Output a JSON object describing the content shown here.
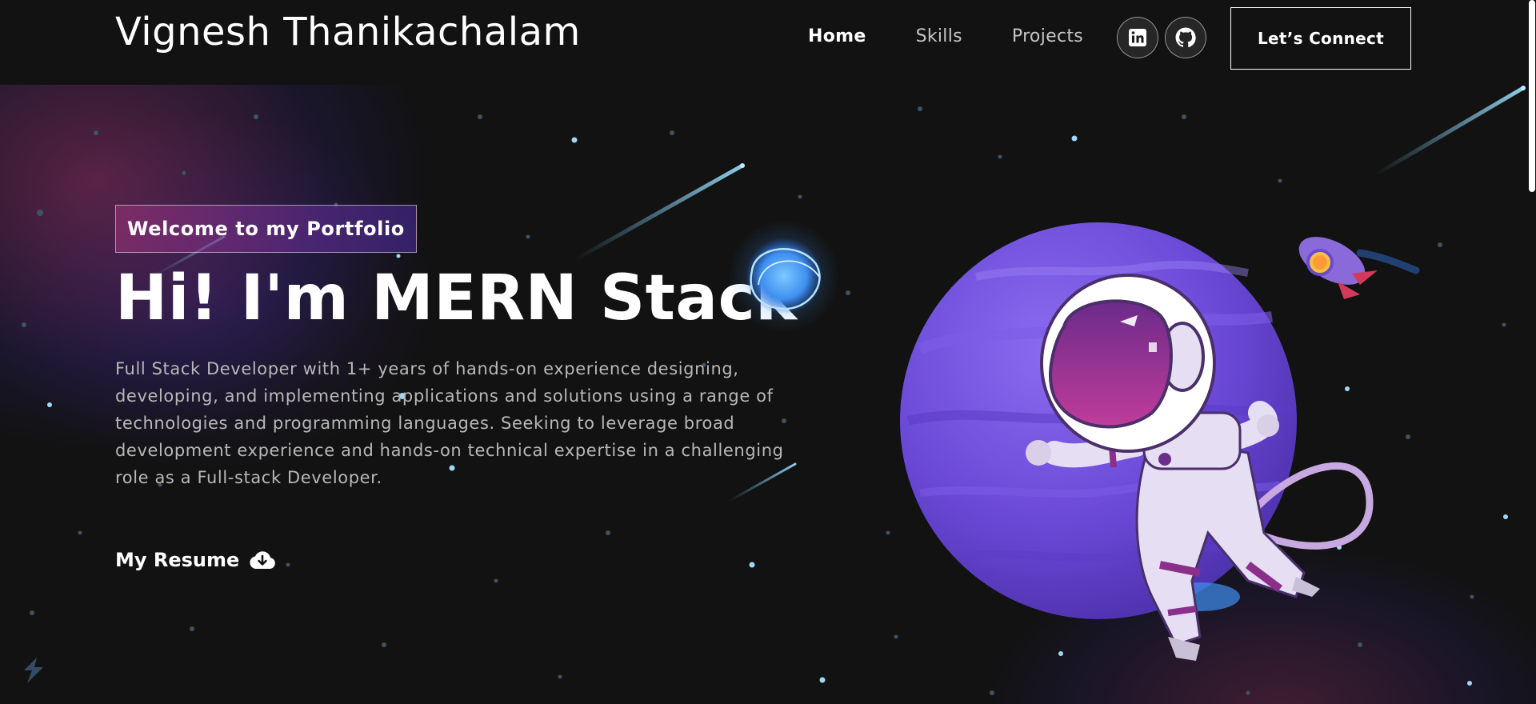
{
  "navbar": {
    "brand": "Vignesh Thanikachalam",
    "links": [
      {
        "label": "Home",
        "active": true
      },
      {
        "label": "Skills",
        "active": false
      },
      {
        "label": "Projects",
        "active": false
      }
    ],
    "social": [
      {
        "icon": "linkedin-icon"
      },
      {
        "icon": "github-icon"
      }
    ],
    "connect_label": "Let’s Connect"
  },
  "hero": {
    "tagline": "Welcome to my Portfolio",
    "title": "Hi! I'm MERN Stack",
    "description": "Full Stack Developer with 1+ years of hands-on experience designing, developing, and implementing applications and solutions using a range of technologies and programming languages. Seeking to leverage broad development experience and hands-on technical expertise in a challenging role as a Full-stack Developer.",
    "resume_label": "My Resume",
    "resume_icon": "cloud-download-icon",
    "illustration": "astronaut-planet-illustration"
  },
  "colors": {
    "background": "#121212",
    "accent_pink": "#AA367C",
    "accent_purple": "#4A2FBD",
    "planet": "#6A4BD8",
    "star": "#9FD8F5"
  }
}
